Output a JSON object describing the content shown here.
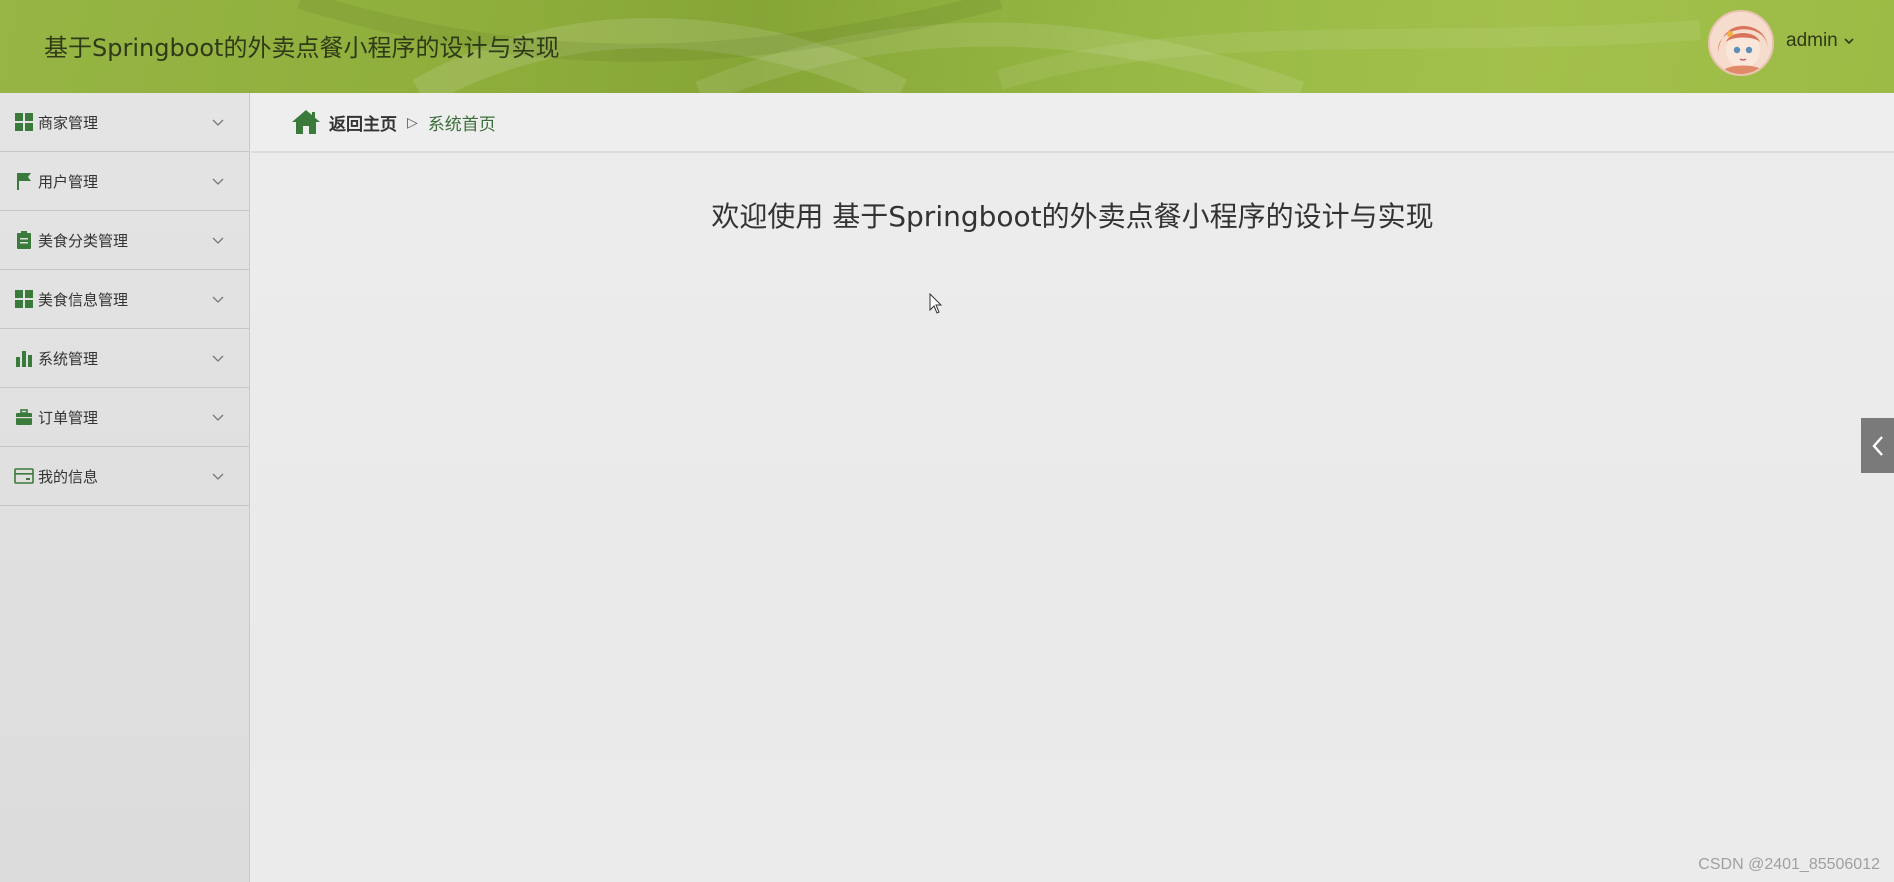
{
  "header": {
    "title": "基于Springboot的外卖点餐小程序的设计与实现",
    "user": {
      "name": "admin",
      "caret_icon": "chevron-down-icon"
    },
    "colors": {
      "header_bg": "#8fae3c",
      "text": "#2f3a18"
    }
  },
  "sidebar": {
    "items": [
      {
        "label": "商家管理",
        "icon": "grid-icon"
      },
      {
        "label": "用户管理",
        "icon": "flag-icon"
      },
      {
        "label": "美食分类管理",
        "icon": "clipboard-icon"
      },
      {
        "label": "美食信息管理",
        "icon": "grid-icon"
      },
      {
        "label": "系统管理",
        "icon": "bar-chart-icon"
      },
      {
        "label": "订单管理",
        "icon": "briefcase-icon"
      },
      {
        "label": "我的信息",
        "icon": "card-icon"
      }
    ],
    "colors": {
      "icon": "#3a7a3a"
    }
  },
  "breadcrumb": {
    "home_label": "返回主页",
    "separator": "▷",
    "current": "系统首页"
  },
  "main": {
    "welcome": "欢迎使用 基于Springboot的外卖点餐小程序的设计与实现"
  },
  "watermark": "CSDN @2401_85506012"
}
